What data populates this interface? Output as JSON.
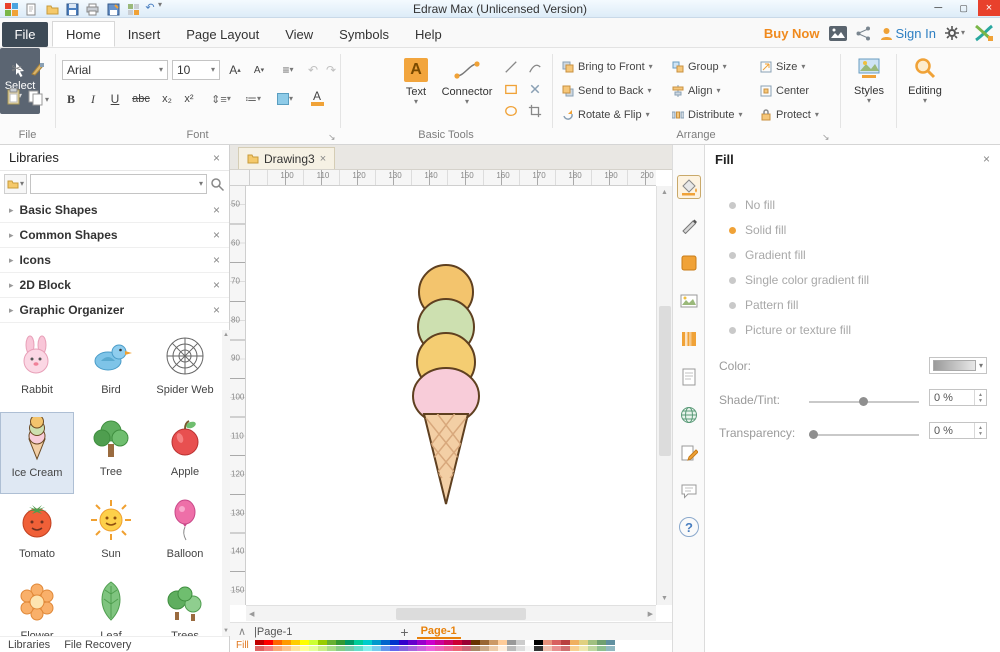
{
  "titlebar": {
    "title": "Edraw Max (Unlicensed Version)",
    "qat_icons": [
      "app-logo",
      "new-document",
      "open-folder",
      "save",
      "print",
      "save-as",
      "grid",
      "undo",
      "customize"
    ]
  },
  "menubar": {
    "file": "File",
    "tabs": [
      "Home",
      "Insert",
      "Page Layout",
      "View",
      "Symbols",
      "Help"
    ],
    "active_tab": "Home",
    "buy_now": "Buy Now",
    "sign_in": "Sign In"
  },
  "ribbon": {
    "font_name": "Arial",
    "font_size": "10",
    "bold": "B",
    "italic": "I",
    "underline": "U",
    "strike": "abc",
    "subscript": "x₂",
    "superscript": "x²",
    "grow_font": "A",
    "shrink_font": "A",
    "font_color_letter": "A",
    "tools": {
      "select": "Select",
      "text": "Text",
      "text_icon_letter": "A",
      "connector": "Connector"
    },
    "arrange": [
      "Bring to Front",
      "Send to Back",
      "Rotate & Flip",
      "Group",
      "Align",
      "Distribute",
      "Size",
      "Center",
      "Protect"
    ],
    "styles": "Styles",
    "editing": "Editing",
    "group_labels": [
      "File",
      "Font",
      "Basic Tools",
      "Arrange"
    ]
  },
  "libraries": {
    "title": "Libraries",
    "search_placeholder": "",
    "categories": [
      "Basic Shapes",
      "Common Shapes",
      "Icons",
      "2D Block",
      "Graphic Organizer"
    ],
    "shapes": [
      "Rabbit",
      "Bird",
      "Spider Web",
      "Ice Cream",
      "Tree",
      "Apple",
      "Tomato",
      "Sun",
      "Balloon",
      "Flower",
      "Leaf",
      "Trees"
    ],
    "selected_shape": "Ice Cream",
    "bottom_tabs": [
      "Libraries",
      "File Recovery"
    ]
  },
  "canvas": {
    "tab": "Drawing3",
    "h_ruler": [
      "100",
      "110",
      "120",
      "130",
      "140",
      "150",
      "160",
      "170",
      "180",
      "190",
      "200"
    ],
    "v_ruler": [
      "50",
      "60",
      "70",
      "80",
      "90",
      "100",
      "110",
      "120",
      "130",
      "140",
      "150"
    ],
    "page_nav": "|Page-1",
    "add_page": "+",
    "page_tab": "Page-1",
    "status_fill": "Fill"
  },
  "fill_panel": {
    "title": "Fill",
    "options": [
      "No fill",
      "Solid fill",
      "Gradient fill",
      "Single color gradient fill",
      "Pattern fill",
      "Picture or texture fill"
    ],
    "selected_option": "Solid fill",
    "color_label": "Color:",
    "shade_label": "Shade/Tint:",
    "transparency_label": "Transparency:",
    "shade_value": "0 %",
    "transparency_value": "0 %"
  },
  "colors": {
    "accent": "#f0a237",
    "select_button": "#5b6572",
    "ice_cream": {
      "scoop_top": "#f3c46d",
      "scoop_green": "#cde0b0",
      "scoop_yellow": "#f4cd72",
      "scoop_pink": "#f8ccd9",
      "cone": "#f3cfa5",
      "lattice": "#d8a87c",
      "outline": "#5f4020"
    }
  },
  "glyphs": {
    "caret_down": "▾",
    "caret_up": "▴",
    "close": "×",
    "minimize": "─",
    "maximize": "▢",
    "collapse": "∧",
    "plus": "+",
    "scissors": "✂",
    "undo": "↶",
    "redo": "↷",
    "align": "≡",
    "bullets": "≔",
    "up": "▲",
    "down": "▼",
    "left": "◀",
    "right": "▶"
  },
  "palette": {
    "row1": [
      "#c00000",
      "#ff0000",
      "#ff6600",
      "#ff9900",
      "#ffcc00",
      "#ffff00",
      "#ccff33",
      "#99cc00",
      "#66b032",
      "#339933",
      "#009966",
      "#00cc99",
      "#00cccc",
      "#0099cc",
      "#0066cc",
      "#0033cc",
      "#3300cc",
      "#6600cc",
      "#9900cc",
      "#cc00cc",
      "#cc0099",
      "#cc0066",
      "#cc0033",
      "#990033",
      "#663300",
      "#996633",
      "#cc9966",
      "#ffcc99",
      "#999999",
      "#cccccc",
      "#ffffff",
      "#000000",
      "#e8927c",
      "#d86060",
      "#b84040",
      "#f0b060",
      "#e0d080",
      "#a0c080",
      "#70a070",
      "#6090a0"
    ],
    "row2": [
      "#e06666",
      "#f28080",
      "#f9a978",
      "#fbc490",
      "#fde4a0",
      "#ffff99",
      "#e6ff99",
      "#ccee88",
      "#aadd88",
      "#88cc88",
      "#77ccaa",
      "#66ddcc",
      "#88eeee",
      "#77ccee",
      "#6699ee",
      "#6666ee",
      "#8866dd",
      "#aa66dd",
      "#cc66dd",
      "#ee66dd",
      "#ee66bb",
      "#ee6699",
      "#ee6677",
      "#cc6677",
      "#aa8866",
      "#ccaa88",
      "#eeccaa",
      "#ffeedd",
      "#bbbbbb",
      "#dddddd",
      "#f5f5f5",
      "#333333",
      "#f0c0b0",
      "#e89090",
      "#d07070",
      "#f8d090",
      "#f0e8b0",
      "#c0d8a0",
      "#90c090",
      "#90b8c0"
    ]
  }
}
